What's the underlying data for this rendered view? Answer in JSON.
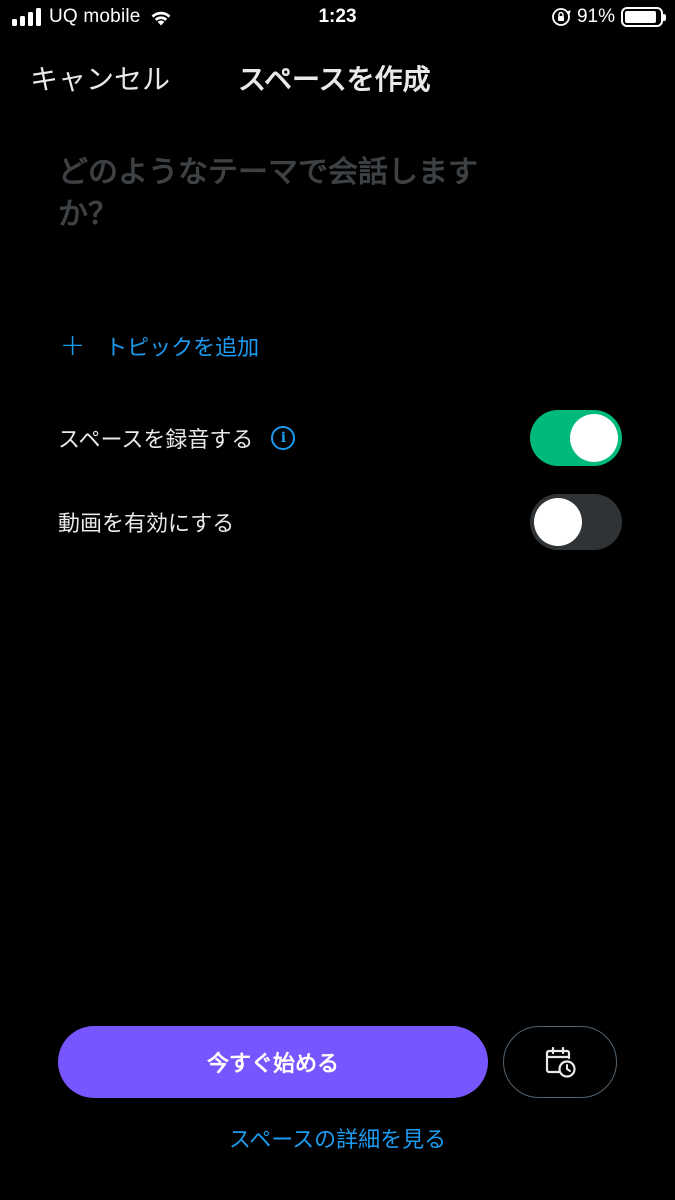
{
  "status_bar": {
    "carrier": "UQ mobile",
    "time": "1:23",
    "battery_percent": "91%",
    "battery_level": 0.91,
    "signal_bars": 4,
    "icons": [
      "signal-icon",
      "wifi-icon",
      "orientation-lock-icon",
      "battery-icon"
    ]
  },
  "header": {
    "cancel_label": "キャンセル",
    "title": "スペースを作成"
  },
  "topic_input": {
    "placeholder": "どのようなテーマで会話しますか？"
  },
  "add_topic": {
    "icon": "plus-icon",
    "label": "トピックを追加"
  },
  "settings": [
    {
      "label": "スペースを録音する",
      "has_info": true,
      "enabled": true
    },
    {
      "label": "動画を有効にする",
      "has_info": false,
      "enabled": false
    }
  ],
  "actions": {
    "start_label": "今すぐ始める",
    "schedule_icon": "calendar-clock-icon",
    "details_link": "スペースの詳細を見る"
  },
  "colors": {
    "background": "#000000",
    "accent_blue": "#1d9bf0",
    "toggle_on": "#00ba7c",
    "toggle_off": "#2f3336",
    "primary_button": "#7856ff",
    "placeholder_text": "#3e4144"
  }
}
